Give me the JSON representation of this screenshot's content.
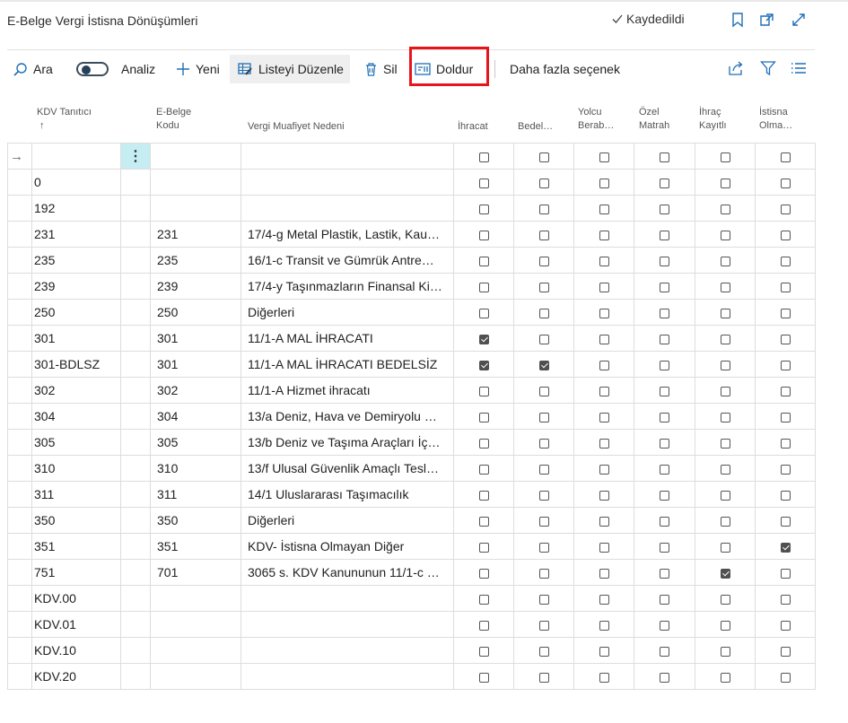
{
  "header": {
    "title": "E-Belge Vergi İstisna Dönüşümleri",
    "saved_label": "Kaydedildi"
  },
  "toolbar": {
    "search": "Ara",
    "analysis": "Analiz",
    "new": "Yeni",
    "edit_list": "Listeyi Düzenle",
    "delete": "Sil",
    "fill": "Doldur",
    "more": "Daha fazla seçenek"
  },
  "columns": {
    "kdv_id": [
      "KDV Tanıtıcı",
      "↑"
    ],
    "ebelge_code": [
      "E-Belge",
      "Kodu"
    ],
    "reason": "Vergi Muafiyet Nedeni",
    "ihracat": "İhracat",
    "bedelsiz": "Bedel…",
    "yolcu": [
      "Yolcu",
      "Berab…"
    ],
    "ozel": [
      "Özel",
      "Matrah"
    ],
    "ihrac_kayitli": [
      "İhraç",
      "Kayıtlı"
    ],
    "istisna": [
      "İstisna",
      "Olma…"
    ]
  },
  "new_row_indicator": "→",
  "row_menu_glyph": "⋮",
  "rows": [
    {
      "kdv": "0",
      "code": "",
      "reason": "",
      "checks": [
        false,
        false,
        false,
        false,
        false,
        false
      ]
    },
    {
      "kdv": "192",
      "code": "",
      "reason": "",
      "checks": [
        false,
        false,
        false,
        false,
        false,
        false
      ]
    },
    {
      "kdv": "231",
      "code": "231",
      "reason": "17/4-g Metal Plastik, Lastik, Kau…",
      "checks": [
        false,
        false,
        false,
        false,
        false,
        false
      ]
    },
    {
      "kdv": "235",
      "code": "235",
      "reason": "16/1-c Transit ve Gümrük Antre…",
      "checks": [
        false,
        false,
        false,
        false,
        false,
        false
      ]
    },
    {
      "kdv": "239",
      "code": "239",
      "reason": "17/4-y Taşınmazların Finansal Ki…",
      "checks": [
        false,
        false,
        false,
        false,
        false,
        false
      ]
    },
    {
      "kdv": "250",
      "code": "250",
      "reason": "Diğerleri",
      "checks": [
        false,
        false,
        false,
        false,
        false,
        false
      ]
    },
    {
      "kdv": "301",
      "code": "301",
      "reason": "11/1-A MAL İHRACATI",
      "checks": [
        true,
        false,
        false,
        false,
        false,
        false
      ]
    },
    {
      "kdv": "301-BDLSZ",
      "code": "301",
      "reason": "11/1-A MAL İHRACATI BEDELSİZ",
      "checks": [
        true,
        true,
        false,
        false,
        false,
        false
      ]
    },
    {
      "kdv": "302",
      "code": "302",
      "reason": "11/1-A Hizmet ihracatı",
      "checks": [
        false,
        false,
        false,
        false,
        false,
        false
      ]
    },
    {
      "kdv": "304",
      "code": "304",
      "reason": "13/a Deniz, Hava ve Demiryolu …",
      "checks": [
        false,
        false,
        false,
        false,
        false,
        false
      ]
    },
    {
      "kdv": "305",
      "code": "305",
      "reason": "13/b Deniz ve Taşıma Araçları İç…",
      "checks": [
        false,
        false,
        false,
        false,
        false,
        false
      ]
    },
    {
      "kdv": "310",
      "code": "310",
      "reason": "13/f Ulusal Güvenlik Amaçlı Tesl…",
      "checks": [
        false,
        false,
        false,
        false,
        false,
        false
      ]
    },
    {
      "kdv": "311",
      "code": "311",
      "reason": "14/1 Uluslararası Taşımacılık",
      "checks": [
        false,
        false,
        false,
        false,
        false,
        false
      ]
    },
    {
      "kdv": "350",
      "code": "350",
      "reason": "Diğerleri",
      "checks": [
        false,
        false,
        false,
        false,
        false,
        false
      ]
    },
    {
      "kdv": "351",
      "code": "351",
      "reason": "KDV- İstisna Olmayan Diğer",
      "checks": [
        false,
        false,
        false,
        false,
        false,
        true
      ]
    },
    {
      "kdv": "751",
      "code": "701",
      "reason": "3065 s. KDV Kanununun 11/1-c …",
      "checks": [
        false,
        false,
        false,
        false,
        true,
        false
      ]
    },
    {
      "kdv": "KDV.00",
      "code": "",
      "reason": "",
      "checks": [
        false,
        false,
        false,
        false,
        false,
        false
      ]
    },
    {
      "kdv": "KDV.01",
      "code": "",
      "reason": "",
      "checks": [
        false,
        false,
        false,
        false,
        false,
        false
      ]
    },
    {
      "kdv": "KDV.10",
      "code": "",
      "reason": "",
      "checks": [
        false,
        false,
        false,
        false,
        false,
        false
      ]
    },
    {
      "kdv": "KDV.20",
      "code": "",
      "reason": "",
      "checks": [
        false,
        false,
        false,
        false,
        false,
        false
      ]
    }
  ],
  "colors": {
    "highlight": "#e8141c",
    "selected_cell": "#c5edf2",
    "accent": "#1e6fb5"
  }
}
